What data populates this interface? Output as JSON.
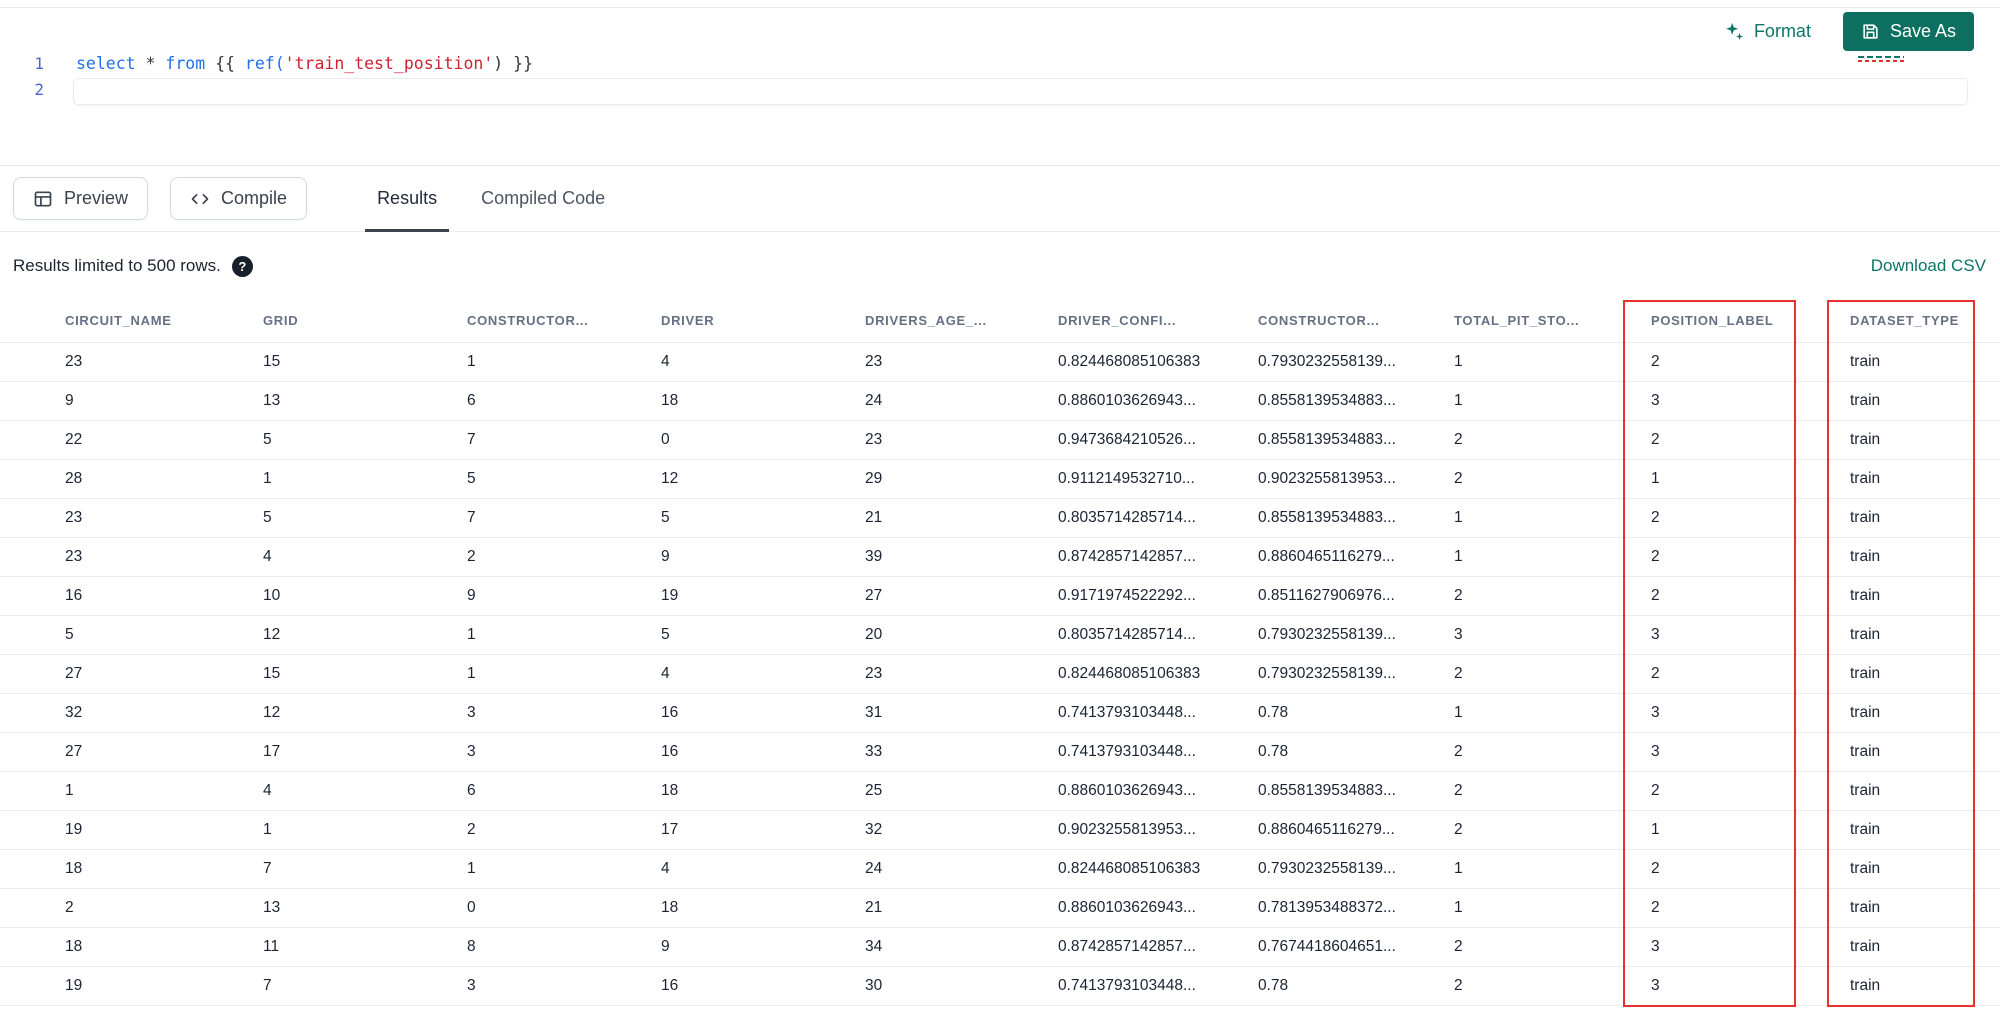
{
  "editor": {
    "line_numbers": [
      "1",
      "2"
    ],
    "code_tokens": [
      {
        "text": "select ",
        "type": "keyword"
      },
      {
        "text": "* ",
        "type": "plain"
      },
      {
        "text": "from ",
        "type": "keyword"
      },
      {
        "text": "{{ ",
        "type": "plain"
      },
      {
        "text": "ref(",
        "type": "function"
      },
      {
        "text": "'train_test_position'",
        "type": "string"
      },
      {
        "text": ") ",
        "type": "plain"
      },
      {
        "text": "}}",
        "type": "plain"
      }
    ]
  },
  "toolbar": {
    "format_label": "Format",
    "save_as_label": "Save As"
  },
  "action_bar": {
    "preview_label": "Preview",
    "compile_label": "Compile",
    "tabs": [
      {
        "label": "Results",
        "active": true
      },
      {
        "label": "Compiled Code",
        "active": false
      }
    ]
  },
  "results": {
    "limit_notice": "Results limited to 500 rows.",
    "help_glyph": "?",
    "download_csv_label": "Download CSV",
    "columns": [
      "CIRCUIT_NAME",
      "GRID",
      "CONSTRUCTOR...",
      "DRIVER",
      "DRIVERS_AGE_...",
      "DRIVER_CONFI...",
      "CONSTRUCTOR...",
      "TOTAL_PIT_STO...",
      "POSITION_LABEL",
      "DATASET_TYPE"
    ],
    "rows": [
      [
        "23",
        "15",
        "1",
        "4",
        "23",
        "0.824468085106383",
        "0.7930232558139...",
        "1",
        "2",
        "train"
      ],
      [
        "9",
        "13",
        "6",
        "18",
        "24",
        "0.8860103626943...",
        "0.8558139534883...",
        "1",
        "3",
        "train"
      ],
      [
        "22",
        "5",
        "7",
        "0",
        "23",
        "0.9473684210526...",
        "0.8558139534883...",
        "2",
        "2",
        "train"
      ],
      [
        "28",
        "1",
        "5",
        "12",
        "29",
        "0.9112149532710...",
        "0.9023255813953...",
        "2",
        "1",
        "train"
      ],
      [
        "23",
        "5",
        "7",
        "5",
        "21",
        "0.8035714285714...",
        "0.8558139534883...",
        "1",
        "2",
        "train"
      ],
      [
        "23",
        "4",
        "2",
        "9",
        "39",
        "0.8742857142857...",
        "0.8860465116279...",
        "1",
        "2",
        "train"
      ],
      [
        "16",
        "10",
        "9",
        "19",
        "27",
        "0.9171974522292...",
        "0.8511627906976...",
        "2",
        "2",
        "train"
      ],
      [
        "5",
        "12",
        "1",
        "5",
        "20",
        "0.8035714285714...",
        "0.7930232558139...",
        "3",
        "3",
        "train"
      ],
      [
        "27",
        "15",
        "1",
        "4",
        "23",
        "0.824468085106383",
        "0.7930232558139...",
        "2",
        "2",
        "train"
      ],
      [
        "32",
        "12",
        "3",
        "16",
        "31",
        "0.7413793103448...",
        "0.78",
        "1",
        "3",
        "train"
      ],
      [
        "27",
        "17",
        "3",
        "16",
        "33",
        "0.7413793103448...",
        "0.78",
        "2",
        "3",
        "train"
      ],
      [
        "1",
        "4",
        "6",
        "18",
        "25",
        "0.8860103626943...",
        "0.8558139534883...",
        "2",
        "2",
        "train"
      ],
      [
        "19",
        "1",
        "2",
        "17",
        "32",
        "0.9023255813953...",
        "0.8860465116279...",
        "2",
        "1",
        "train"
      ],
      [
        "18",
        "7",
        "1",
        "4",
        "24",
        "0.824468085106383",
        "0.7930232558139...",
        "1",
        "2",
        "train"
      ],
      [
        "2",
        "13",
        "0",
        "18",
        "21",
        "0.8860103626943...",
        "0.7813953488372...",
        "1",
        "2",
        "train"
      ],
      [
        "18",
        "11",
        "8",
        "9",
        "34",
        "0.8742857142857...",
        "0.7674418604651...",
        "2",
        "3",
        "train"
      ],
      [
        "19",
        "7",
        "3",
        "16",
        "30",
        "0.7413793103448...",
        "0.78",
        "2",
        "3",
        "train"
      ]
    ],
    "highlighted_columns": [
      "POSITION_LABEL",
      "DATASET_TYPE"
    ]
  },
  "colors": {
    "accent_teal": "#0e7569",
    "save_button_teal": "#0c6f60",
    "highlight_red": "#e5322e"
  }
}
